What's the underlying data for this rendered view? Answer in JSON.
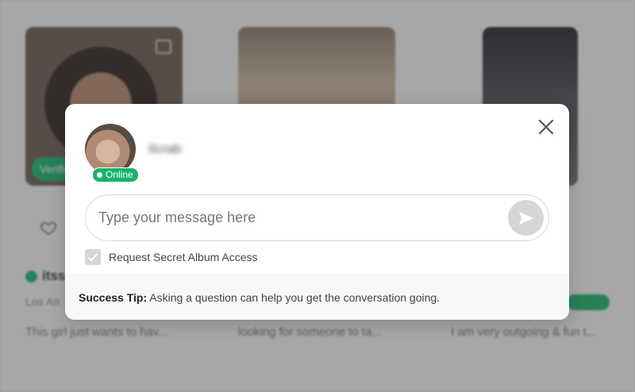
{
  "background": {
    "cards": [
      {
        "badge": "Verified",
        "name": "itss",
        "location": "Los An",
        "bio": "This girl just wants to hav..."
      },
      {
        "bio": "looking for someone to ta..."
      },
      {
        "bio": "I am very outgoing & fun t..."
      }
    ]
  },
  "modal": {
    "user": {
      "name": "Ilcrab",
      "status": "Online"
    },
    "message": {
      "placeholder": "Type your message here",
      "value": ""
    },
    "secret_album": {
      "label": "Request Secret Album Access",
      "checked": true
    },
    "tip": {
      "label": "Success Tip:",
      "text": " Asking a question can help you get the conversation going."
    },
    "icons": {
      "close": "close-icon",
      "send": "send-icon",
      "check": "check-icon"
    },
    "colors": {
      "online_green": "#19b36b",
      "send_disabled": "#d6d6d6"
    }
  }
}
